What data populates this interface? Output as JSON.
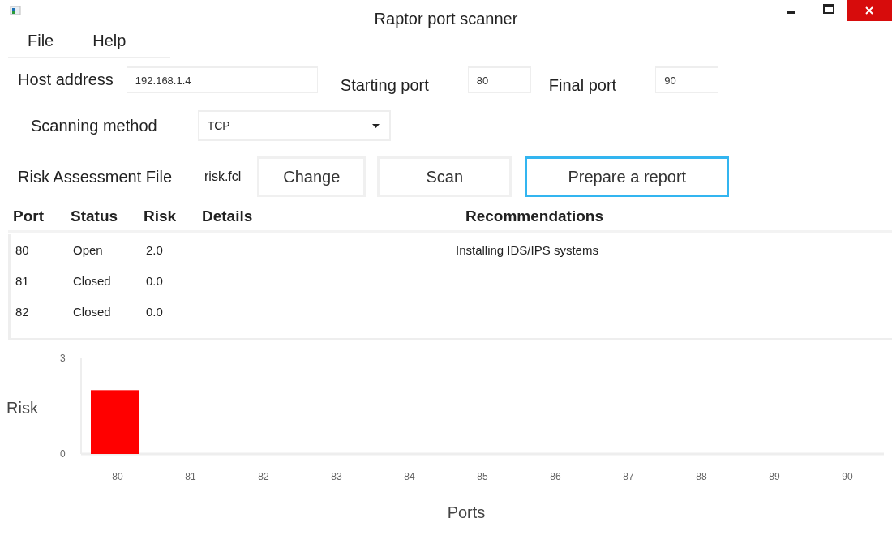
{
  "window": {
    "title": "Raptor port scanner"
  },
  "menu": [
    {
      "label": "File"
    },
    {
      "label": "Help"
    }
  ],
  "form": {
    "host_label": "Host address",
    "host_value": "192.168.1.4",
    "start_label": "Starting port",
    "start_value": "80",
    "final_label": "Final port",
    "final_value": "90",
    "method_label": "Scanning method",
    "method_value": "TCP",
    "risk_file_label": "Risk Assessment File",
    "risk_file_value": "risk.fcl"
  },
  "buttons": [
    {
      "label": "Change",
      "focused": false
    },
    {
      "label": "Scan",
      "focused": false
    },
    {
      "label": "Prepare a report",
      "focused": true
    }
  ],
  "table": {
    "columns": [
      "Port",
      "Status",
      "Risk",
      "Details",
      "Recommendations"
    ],
    "rows": [
      [
        "80",
        "Open",
        "2.0",
        "",
        "Installing IDS/IPS systems"
      ],
      [
        "81",
        "Closed",
        "0.0",
        "",
        ""
      ],
      [
        "82",
        "Closed",
        "0.0",
        "",
        ""
      ]
    ]
  },
  "chart_data": {
    "type": "bar",
    "xlabel": "Ports",
    "ylabel": "Risk",
    "categories": [
      "80",
      "81",
      "82",
      "83",
      "84",
      "85",
      "86",
      "87",
      "88",
      "89",
      "90"
    ],
    "series": [
      {
        "color": "#ff0000",
        "values": [
          2,
          0,
          0,
          0,
          0,
          0,
          0,
          0,
          0,
          0,
          0
        ]
      }
    ],
    "ylim": [
      0,
      3
    ],
    "yticks": [
      0,
      3
    ]
  }
}
